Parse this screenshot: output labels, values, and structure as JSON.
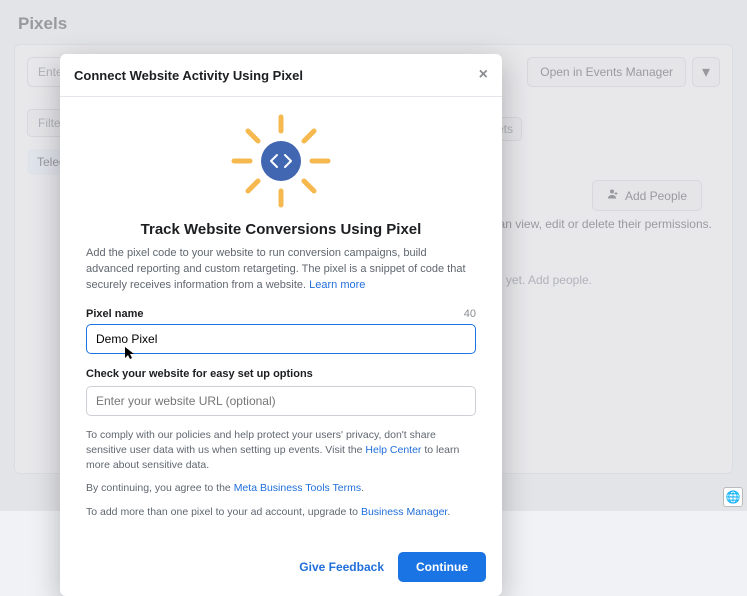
{
  "page": {
    "title": "Pixels",
    "search_placeholder": "Enter ID",
    "filter_label": "Filter b",
    "row_label": "Telegin",
    "events_manager": "Open in Events Manager",
    "frag_ets": "ets",
    "add_people": "Add People",
    "permissions_fragment": ". You can view, edit or delete their permissions.",
    "add_people_fragment": "ed yet. Add people."
  },
  "modal": {
    "header": "Connect Website Activity Using Pixel",
    "title": "Track Website Conversions Using Pixel",
    "description": "Add the pixel code to your website to run conversion campaigns, build advanced reporting and custom retargeting. The pixel is a snippet of code that securely receives information from a website. ",
    "learn_more": "Learn more",
    "pixel_name_label": "Pixel name",
    "pixel_name_counter": "40",
    "pixel_name_value": "Demo Pixel",
    "check_website_label": "Check your website for easy set up options",
    "website_placeholder": "Enter your website URL (optional)",
    "policy1_a": "To comply with our policies and help protect your users' privacy, don't share sensitive user data with us when setting up events. Visit the ",
    "policy1_link": "Help Center",
    "policy1_b": " to learn more about sensitive data.",
    "policy2_a": "By continuing, you agree to the ",
    "policy2_link": "Meta Business Tools Terms",
    "policy2_b": ".",
    "policy3_a": "To add more than one pixel to your ad account, upgrade to ",
    "policy3_link": "Business Manager",
    "policy3_b": ".",
    "give_feedback": "Give Feedback",
    "continue": "Continue"
  }
}
